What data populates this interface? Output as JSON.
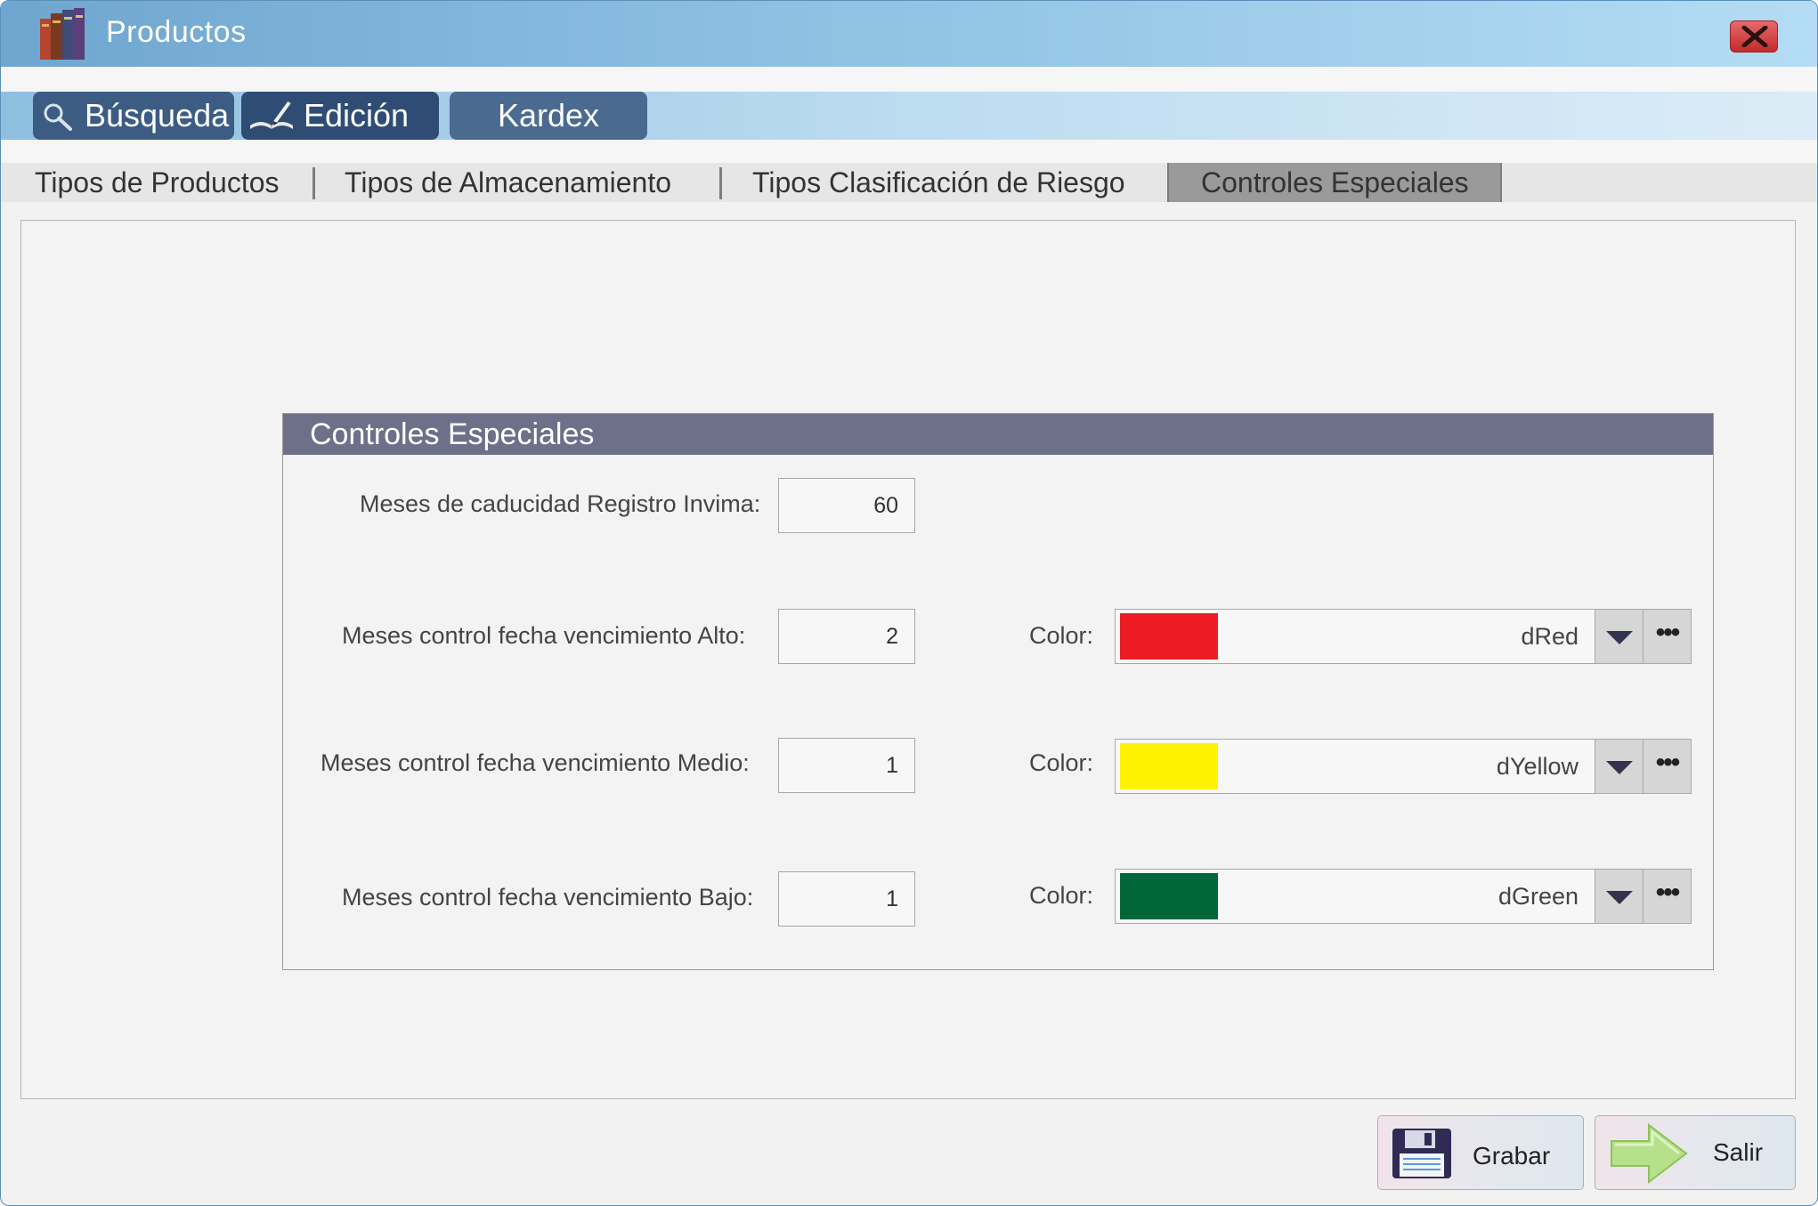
{
  "window": {
    "title": "Productos"
  },
  "module_tabs": [
    {
      "label": "Búsqueda"
    },
    {
      "label": "Edición"
    },
    {
      "label": "Kardex"
    }
  ],
  "sub_tabs": [
    {
      "label": "Tipos de Productos"
    },
    {
      "label": "Tipos de Almacenamiento"
    },
    {
      "label": "Tipos Clasificación de Riesgo"
    },
    {
      "label": "Controles Especiales",
      "active": true
    }
  ],
  "group": {
    "title": "Controles Especiales",
    "invima": {
      "label": "Meses de caducidad Registro Invima:",
      "value": "60"
    },
    "rows": [
      {
        "label": "Meses control fecha vencimiento Alto:",
        "value": "2",
        "color_label": "Color:",
        "color_name": "dRed",
        "swatch": "#ed1c24"
      },
      {
        "label": "Meses control fecha vencimiento Medio:",
        "value": "1",
        "color_label": "Color:",
        "color_name": "dYellow",
        "swatch": "#fff200"
      },
      {
        "label": "Meses control fecha vencimiento Bajo:",
        "value": "1",
        "color_label": "Color:",
        "color_name": "dGreen",
        "swatch": "#006838"
      }
    ]
  },
  "buttons": {
    "save_label": "Grabar",
    "exit_label": "Salir"
  },
  "icons": {
    "app": "books-icon",
    "close": "close-icon",
    "search": "magnifier-icon",
    "edit": "book-pen-icon",
    "dropdown": "chevron-down-icon",
    "more": "ellipsis-icon",
    "save": "floppy-disk-icon",
    "exit": "arrow-right-icon"
  }
}
